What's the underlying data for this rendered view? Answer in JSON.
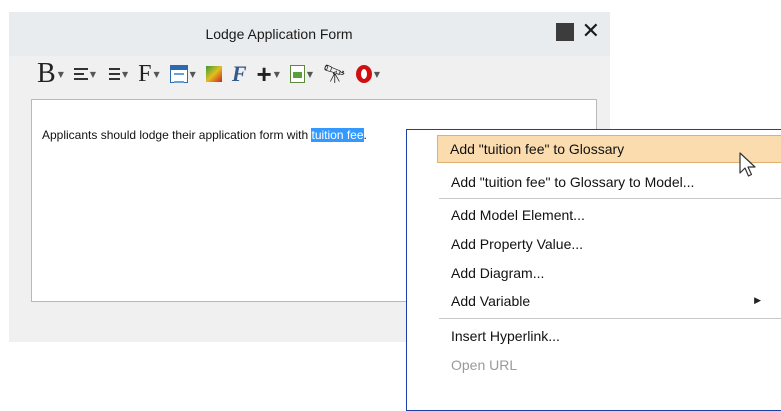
{
  "window": {
    "title": "Lodge Application Form"
  },
  "toolbar": {
    "items": [
      {
        "icon": "bold-icon"
      },
      {
        "icon": "align-icon"
      },
      {
        "icon": "list-icon"
      },
      {
        "icon": "font-icon"
      },
      {
        "icon": "table-icon"
      },
      {
        "icon": "color-icon"
      },
      {
        "icon": "formula-icon"
      },
      {
        "icon": "insert-icon"
      },
      {
        "icon": "document-icon"
      },
      {
        "icon": "find-icon"
      },
      {
        "icon": "spellcheck-icon"
      }
    ],
    "labels": {
      "bold": "B",
      "font": "F",
      "formula": "F",
      "plus": "+"
    }
  },
  "editor": {
    "text_before": "Applicants should lodge their application form with ",
    "selected_text": "tuition fee",
    "text_after": "."
  },
  "context_menu": {
    "items": [
      {
        "label": "Add \"tuition fee\" to Glossary",
        "highlighted": true
      },
      {
        "label": "Add \"tuition fee\" to Glossary to Model..."
      },
      {
        "label": "Add Model Element..."
      },
      {
        "label": "Add Property Value..."
      },
      {
        "label": "Add Diagram..."
      },
      {
        "label": "Add Variable",
        "submenu": true
      },
      {
        "label": "Insert Hyperlink..."
      },
      {
        "label": "Open URL",
        "disabled": true
      }
    ]
  }
}
